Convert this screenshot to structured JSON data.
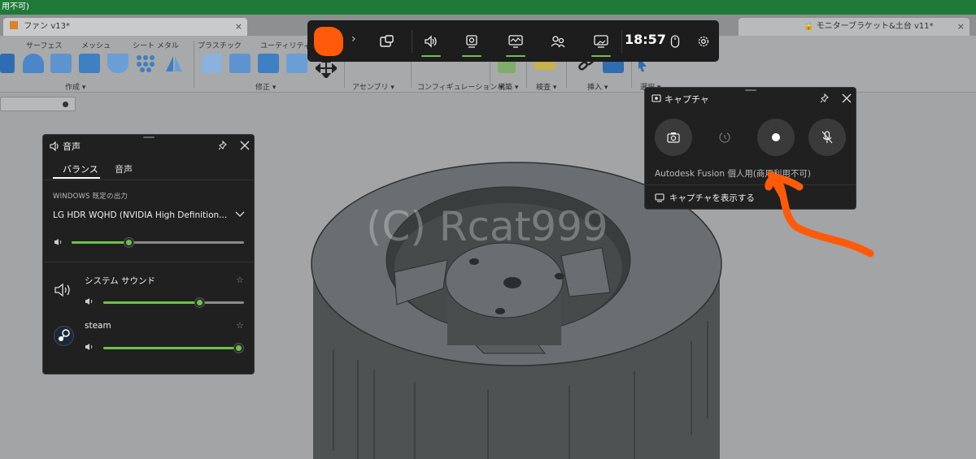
{
  "fusion": {
    "top_title_fragment": "用不可)",
    "tabs": [
      {
        "label": "ファン v13*",
        "close": "×"
      },
      {
        "label": "🔒 モニターブラケット&土台 v11*",
        "close": "×"
      }
    ],
    "ribbon_labels": [
      "サーフェス",
      "メッシュ",
      "シート メタル",
      "プラスチック",
      "ユーティリティ"
    ],
    "group_labels": [
      "作成 ▾",
      "修正 ▾",
      "アセンブリ ▾",
      "コンフィギュレーション ▾",
      "構築 ▾",
      "検査 ▾",
      "挿入 ▾",
      "選択 ▾"
    ],
    "watermark": "(C) Rcat999"
  },
  "gamebar": {
    "chevron": "›",
    "time": "18:57",
    "buttons": [
      {
        "icon": "widget-menu-icon"
      },
      {
        "icon": "audio-icon",
        "active": true
      },
      {
        "icon": "capture-icon",
        "active": true
      },
      {
        "icon": "performance-icon",
        "active": true
      },
      {
        "icon": "xbox-social-icon"
      },
      {
        "icon": "gallery-icon",
        "active": true
      },
      {
        "icon": "mouse-icon"
      },
      {
        "icon": "settings-icon"
      }
    ],
    "accent": "#6cc24a",
    "logo_color": "#ff5a0a"
  },
  "audio": {
    "title": "音声",
    "tabs": [
      "バランス",
      "音声"
    ],
    "output_caption": "WINDOWS 既定の出力",
    "device": "LG HDR WQHD (NVIDIA High Definition...",
    "master_volume": 0.33,
    "apps": [
      {
        "name": "システム サウンド",
        "volume": 0.68
      },
      {
        "name": "steam",
        "volume": 1.0
      }
    ]
  },
  "capture": {
    "title": "キャプチャ",
    "status": "Autodesk Fusion 個人用(商用利用不可)",
    "show_captures": "キャプチャを表示する",
    "buttons": [
      "screenshot-icon",
      "record-last-icon",
      "record-icon",
      "mic-off-icon"
    ]
  }
}
